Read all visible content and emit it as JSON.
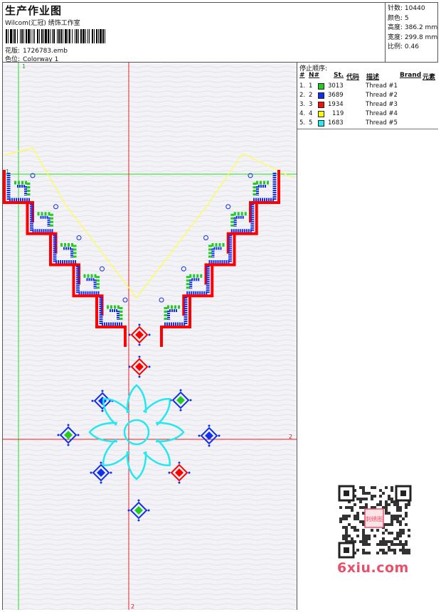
{
  "header": {
    "title": "生产作业图",
    "company": "Wilcom(汇冠) 绣饰工作室",
    "design_label": "花版:",
    "design_value": "1726783.emb",
    "colorway_label": "色位:",
    "colorway_value": "Colorway 1"
  },
  "specs": [
    {
      "label": "针数:",
      "value": "10440"
    },
    {
      "label": "颜色:",
      "value": "5"
    },
    {
      "label": "高度:",
      "value": "386.2 mm"
    },
    {
      "label": "宽度:",
      "value": "299.8 mm"
    },
    {
      "label": "比例:",
      "value": "0.46"
    }
  ],
  "canvas": {
    "marker_top": "1",
    "marker_left": "1",
    "marker_right": "2",
    "marker_bottom": "2",
    "colors": {
      "green": "#22cc22",
      "red": "#ff0000",
      "blue": "#1030ee",
      "yellow": "#ffff44",
      "cyan": "#22e8f0",
      "bg": "#f3f2f6"
    }
  },
  "stop_sequence": {
    "title": "停止顺序:",
    "headers": [
      "#",
      "N#",
      "St.",
      "代码",
      "描述",
      "Brand",
      "元素"
    ],
    "rows": [
      {
        "n": "1.",
        "num": "1",
        "color": "#22cc22",
        "code": "3013",
        "desc": "Thread #1"
      },
      {
        "n": "2.",
        "num": "2",
        "color": "#1030ee",
        "code": "3689",
        "desc": "Thread #2"
      },
      {
        "n": "3.",
        "num": "3",
        "color": "#ee1111",
        "code": "1934",
        "desc": "Thread #3"
      },
      {
        "n": "4.",
        "num": "4",
        "color": "#ffff00",
        "code": "119",
        "desc": "Thread #4"
      },
      {
        "n": "5.",
        "num": "5",
        "color": "#22eeee",
        "code": "1683",
        "desc": "Thread #5"
      }
    ]
  },
  "watermark": {
    "site": "6xiu.com",
    "stamp": "刺绣图"
  }
}
